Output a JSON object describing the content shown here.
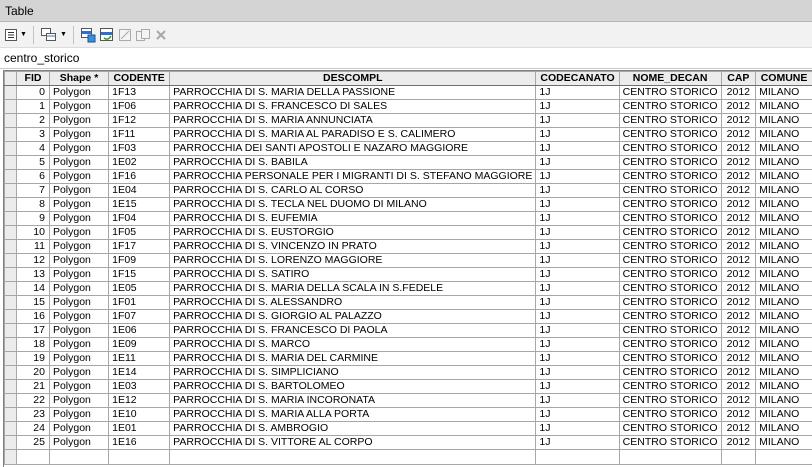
{
  "window": {
    "title": "Table"
  },
  "toolbar": {
    "buttons": [
      {
        "name": "table-options",
        "icon": "table-options-icon"
      },
      {
        "name": "related-tables",
        "icon": "related-tables-icon"
      },
      {
        "name": "select-by-attributes",
        "icon": "select-by-attributes-icon"
      },
      {
        "name": "switch-selection",
        "icon": "switch-selection-icon"
      },
      {
        "name": "clear-selection",
        "icon": "clear-selection-icon"
      },
      {
        "name": "copy-selected",
        "icon": "copy-selected-icon"
      },
      {
        "name": "delete-selected",
        "icon": "delete-icon"
      }
    ]
  },
  "layer_tab": {
    "label": "centro_storico"
  },
  "table": {
    "columns": [
      "FID",
      "Shape *",
      "CODENTE",
      "DESCOMPL",
      "CODECANATO",
      "NOME_DECAN",
      "CAP",
      "COMUNE"
    ],
    "rows": [
      [
        "0",
        "Polygon",
        "1F13",
        "PARROCCHIA DI S. MARIA DELLA PASSIONE",
        "1J",
        "CENTRO STORICO",
        "2012",
        "MILANO"
      ],
      [
        "1",
        "Polygon",
        "1F06",
        "PARROCCHIA DI S. FRANCESCO DI SALES",
        "1J",
        "CENTRO STORICO",
        "2012",
        "MILANO"
      ],
      [
        "2",
        "Polygon",
        "1F12",
        "PARROCCHIA DI S. MARIA ANNUNCIATA",
        "1J",
        "CENTRO STORICO",
        "2012",
        "MILANO"
      ],
      [
        "3",
        "Polygon",
        "1F11",
        "PARROCCHIA DI S. MARIA AL PARADISO E S. CALIMERO",
        "1J",
        "CENTRO STORICO",
        "2012",
        "MILANO"
      ],
      [
        "4",
        "Polygon",
        "1F03",
        "PARROCCHIA DEI SANTI APOSTOLI E NAZARO MAGGIORE",
        "1J",
        "CENTRO STORICO",
        "2012",
        "MILANO"
      ],
      [
        "5",
        "Polygon",
        "1E02",
        "PARROCCHIA DI S. BABILA",
        "1J",
        "CENTRO STORICO",
        "2012",
        "MILANO"
      ],
      [
        "6",
        "Polygon",
        "1F16",
        "PARROCCHIA PERSONALE PER I MIGRANTI DI S. STEFANO MAGGIORE",
        "1J",
        "CENTRO STORICO",
        "2012",
        "MILANO"
      ],
      [
        "7",
        "Polygon",
        "1E04",
        "PARROCCHIA DI S. CARLO AL CORSO",
        "1J",
        "CENTRO STORICO",
        "2012",
        "MILANO"
      ],
      [
        "8",
        "Polygon",
        "1E15",
        "PARROCCHIA DI S. TECLA NEL DUOMO DI MILANO",
        "1J",
        "CENTRO STORICO",
        "2012",
        "MILANO"
      ],
      [
        "9",
        "Polygon",
        "1F04",
        "PARROCCHIA DI S. EUFEMIA",
        "1J",
        "CENTRO STORICO",
        "2012",
        "MILANO"
      ],
      [
        "10",
        "Polygon",
        "1F05",
        "PARROCCHIA DI S. EUSTORGIO",
        "1J",
        "CENTRO STORICO",
        "2012",
        "MILANO"
      ],
      [
        "11",
        "Polygon",
        "1F17",
        "PARROCCHIA DI S. VINCENZO IN PRATO",
        "1J",
        "CENTRO STORICO",
        "2012",
        "MILANO"
      ],
      [
        "12",
        "Polygon",
        "1F09",
        "PARROCCHIA DI S. LORENZO MAGGIORE",
        "1J",
        "CENTRO STORICO",
        "2012",
        "MILANO"
      ],
      [
        "13",
        "Polygon",
        "1F15",
        "PARROCCHIA DI S. SATIRO",
        "1J",
        "CENTRO STORICO",
        "2012",
        "MILANO"
      ],
      [
        "14",
        "Polygon",
        "1E05",
        "PARROCCHIA DI S. MARIA DELLA SCALA IN S.FEDELE",
        "1J",
        "CENTRO STORICO",
        "2012",
        "MILANO"
      ],
      [
        "15",
        "Polygon",
        "1F01",
        "PARROCCHIA DI S. ALESSANDRO",
        "1J",
        "CENTRO STORICO",
        "2012",
        "MILANO"
      ],
      [
        "16",
        "Polygon",
        "1F07",
        "PARROCCHIA DI S. GIORGIO AL PALAZZO",
        "1J",
        "CENTRO STORICO",
        "2012",
        "MILANO"
      ],
      [
        "17",
        "Polygon",
        "1E06",
        "PARROCCHIA DI S. FRANCESCO DI PAOLA",
        "1J",
        "CENTRO STORICO",
        "2012",
        "MILANO"
      ],
      [
        "18",
        "Polygon",
        "1E09",
        "PARROCCHIA DI S. MARCO",
        "1J",
        "CENTRO STORICO",
        "2012",
        "MILANO"
      ],
      [
        "19",
        "Polygon",
        "1E11",
        "PARROCCHIA DI S. MARIA DEL CARMINE",
        "1J",
        "CENTRO STORICO",
        "2012",
        "MILANO"
      ],
      [
        "20",
        "Polygon",
        "1E14",
        "PARROCCHIA DI S. SIMPLICIANO",
        "1J",
        "CENTRO STORICO",
        "2012",
        "MILANO"
      ],
      [
        "21",
        "Polygon",
        "1E03",
        "PARROCCHIA DI S. BARTOLOMEO",
        "1J",
        "CENTRO STORICO",
        "2012",
        "MILANO"
      ],
      [
        "22",
        "Polygon",
        "1E12",
        "PARROCCHIA DI S. MARIA INCORONATA",
        "1J",
        "CENTRO STORICO",
        "2012",
        "MILANO"
      ],
      [
        "23",
        "Polygon",
        "1E10",
        "PARROCCHIA DI S. MARIA ALLA PORTA",
        "1J",
        "CENTRO STORICO",
        "2012",
        "MILANO"
      ],
      [
        "24",
        "Polygon",
        "1E01",
        "PARROCCHIA DI S. AMBROGIO",
        "1J",
        "CENTRO STORICO",
        "2012",
        "MILANO"
      ],
      [
        "25",
        "Polygon",
        "1E16",
        "PARROCCHIA DI S. VITTORE AL CORPO",
        "1J",
        "CENTRO STORICO",
        "2012",
        "MILANO"
      ]
    ]
  }
}
